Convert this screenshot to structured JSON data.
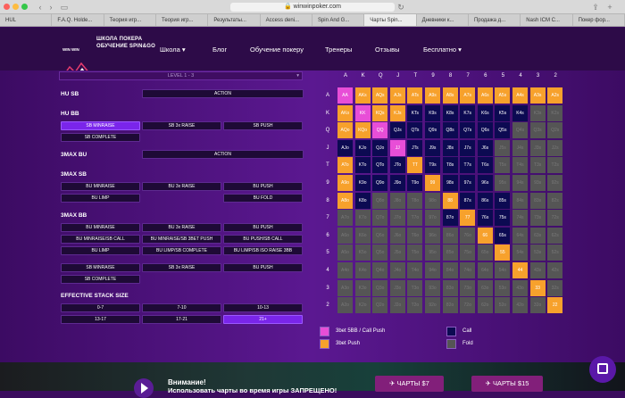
{
  "browser": {
    "url": "winwinpoker.com",
    "tabs": [
      "HUL",
      "F.A.Q. Holde...",
      "Теория игр...",
      "Теория игр...",
      "Результаты...",
      "Access deni...",
      "Spin And G...",
      "Чарты Spin...",
      "Дневники к...",
      "Продажа д...",
      "Nash ICM C...",
      "Покер фор..."
    ],
    "active_tab": 7
  },
  "header": {
    "brand_line1": "ШКОЛА ПОКЕРА",
    "brand_line2": "ОБУЧЕНИЕ SPIN&GO",
    "logo_text": "WIN WIN",
    "nav": [
      "Школа",
      "Блог",
      "Обучение покеру",
      "Тренеры",
      "Отзывы",
      "Бесплатно"
    ],
    "dropdown_marker": "▾"
  },
  "level_select": "LEVEL 1 - 3",
  "sections": {
    "hu_sb": {
      "title": "HU SB",
      "buttons": [
        "ACTION"
      ]
    },
    "hu_bb": {
      "title": "HU BB",
      "buttons": [
        "SB MINRAISE",
        "SB 3x RAISE",
        "SB PUSH",
        "SB COMPLETE"
      ]
    },
    "max3_bu": {
      "title": "3MAX BU",
      "buttons": [
        "ACTION"
      ]
    },
    "max3_sb": {
      "title": "3MAX SB",
      "buttons": [
        "BU MINRAISE",
        "BU 3x RAISE",
        "BU PUSH",
        "BU LIMP",
        "BU FOLD"
      ]
    },
    "max3_bb": {
      "title": "3MAX BB",
      "buttons": [
        "BU MINRAISE",
        "BU 3x RAISE",
        "BU PUSH",
        "BU MINRAISE/SB CALL",
        "BU MINRAISE/SB 3BET PUSH",
        "BU PUSH/SB CALL",
        "BU LIMP",
        "BU LIMP/SB COMPLETE",
        "BU LIMP/SB ISO RAISE 3BB",
        "SB MINRAISE",
        "SB 3x RAISE",
        "BU PUSH",
        "SB COMPLETE"
      ]
    },
    "stack": {
      "title": "EFFECTIVE STACK SIZE",
      "buttons": [
        "0-7",
        "7-10",
        "10-13",
        "13-17",
        "17-21",
        "21+"
      ]
    }
  },
  "ranks": [
    "A",
    "K",
    "Q",
    "J",
    "T",
    "9",
    "8",
    "7",
    "6",
    "5",
    "4",
    "3",
    "2"
  ],
  "grid": [
    "MPPPPPPPPPPPP",
    "PMPPCCCCCCCFF",
    "PPMCCCCCCCFFF",
    "CCCMCCCCCFFFF",
    "PCCCPCCCCFFFF",
    "PCCCCPCCCFFFF",
    "PCFFFFPCCCFFF",
    "FFFFFFCPCCFFF",
    "FFFFFFFFPCFFF",
    "FFFFFFFFFPFFF",
    "FFFFFFFFFFPFF",
    "FFFFFFFFFFFPF",
    "FFFFFFFFFFFFP"
  ],
  "legend": [
    {
      "label": "3bet 5BB / Call Push",
      "color": "#e84ed7"
    },
    {
      "label": "Call",
      "color": "#0c0a52"
    },
    {
      "label": "3bet Push",
      "color": "#f7a12c"
    },
    {
      "label": "Fold",
      "color": "#555555"
    }
  ],
  "footer": {
    "notice_title": "Внимание!",
    "notice_text": "Использовать чарты во время игры ЗАПРЕЩЕНО!",
    "btn1": "ЧАРТЫ $7",
    "btn2": "ЧАРТЫ $15"
  }
}
